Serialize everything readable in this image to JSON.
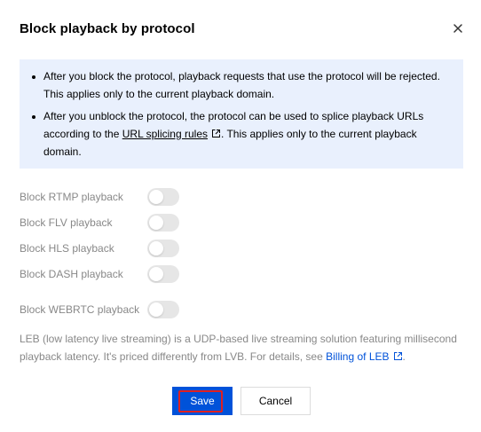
{
  "dialog": {
    "title": "Block playback by protocol",
    "close_icon": "close-icon"
  },
  "notice": {
    "item1": "After you block the protocol, playback requests that use the protocol will be rejected. This applies only to the current playback domain.",
    "item2_before": "After you unblock the protocol, the protocol can be used to splice playback URLs according to the ",
    "item2_link": "URL splicing rules",
    "item2_after": ". This applies only to the current playback domain."
  },
  "toggles": [
    {
      "label": "Block RTMP playback",
      "on": false
    },
    {
      "label": "Block FLV playback",
      "on": false
    },
    {
      "label": "Block HLS playback",
      "on": false
    },
    {
      "label": "Block DASH playback",
      "on": false
    },
    {
      "label": "Block WEBRTC playback",
      "on": false
    }
  ],
  "footnote": {
    "text": "LEB (low latency live streaming) is a UDP-based live streaming solution featuring millisecond playback latency. It's priced differently from LVB. For details, see ",
    "link": "Billing of LEB",
    "end": "."
  },
  "buttons": {
    "save": "Save",
    "cancel": "Cancel"
  },
  "colors": {
    "primary": "#0052d9",
    "notice_bg": "#e9f0fd",
    "highlight_ring": "#e02020"
  }
}
